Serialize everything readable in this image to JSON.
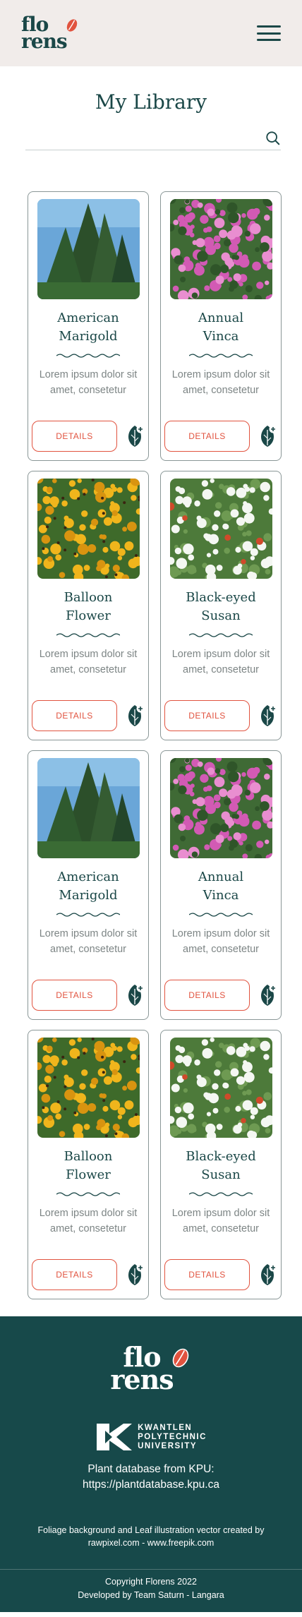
{
  "header": {
    "logo_line1": "flo",
    "logo_line2": "rens",
    "menu_icon": "hamburger-menu-icon"
  },
  "library": {
    "title": "My Library",
    "search_placeholder": "",
    "search_icon": "search-icon"
  },
  "cards": [
    {
      "name_line1": "American",
      "name_line2": "Marigold",
      "description": "Lorem ipsum dolor sit amet, consetetur",
      "button": "DETAILS",
      "image": "conifer-tree"
    },
    {
      "name_line1": "Annual",
      "name_line2": "Vinca",
      "description": "Lorem ipsum dolor sit amet, consetetur",
      "button": "DETAILS",
      "image": "pink-flowers"
    },
    {
      "name_line1": "Balloon",
      "name_line2": "Flower",
      "description": "Lorem ipsum dolor sit amet, consetetur",
      "button": "DETAILS",
      "image": "yellow-flowers"
    },
    {
      "name_line1": "Black-eyed",
      "name_line2": "Susan",
      "description": "Lorem ipsum dolor sit amet, consetetur",
      "button": "DETAILS",
      "image": "white-flowers"
    },
    {
      "name_line1": "American",
      "name_line2": "Marigold",
      "description": "Lorem ipsum dolor sit amet, consetetur",
      "button": "DETAILS",
      "image": "conifer-tree"
    },
    {
      "name_line1": "Annual",
      "name_line2": "Vinca",
      "description": "Lorem ipsum dolor sit amet, consetetur",
      "button": "DETAILS",
      "image": "pink-flowers"
    },
    {
      "name_line1": "Balloon",
      "name_line2": "Flower",
      "description": "Lorem ipsum dolor sit amet, consetetur",
      "button": "DETAILS",
      "image": "yellow-flowers"
    },
    {
      "name_line1": "Black-eyed",
      "name_line2": "Susan",
      "description": "Lorem ipsum dolor sit amet, consetetur",
      "button": "DETAILS",
      "image": "white-flowers"
    }
  ],
  "footer": {
    "logo_line1": "flo",
    "logo_line2": "rens",
    "kpu_line1": "KWANTLEN",
    "kpu_line2": "POLYTECHNIC",
    "kpu_line3": "UNIVERSITY",
    "plantdb_line1": "Plant database from KPU:",
    "plantdb_line2": "https://plantdatabase.kpu.ca",
    "credit": "Foliage background and Leaf illustration vector created by rawpixel.com - www.freepik.com",
    "copyright_line1": "Copyright Florens 2022",
    "copyright_line2": "Developed by Team Saturn - Langara"
  },
  "colors": {
    "brand_dark": "#1a4747",
    "accent": "#e1533f",
    "header_bg": "#f1ecea",
    "footer_bg": "#17494a"
  }
}
